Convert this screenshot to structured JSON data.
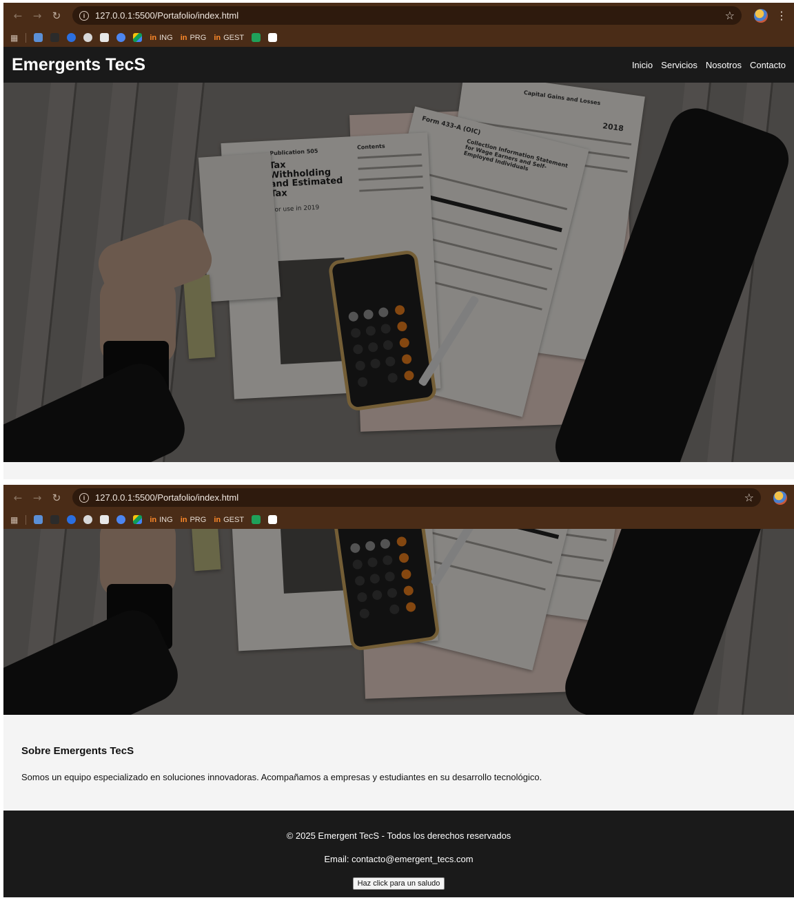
{
  "browser": {
    "url": "127.0.0.1:5500/Portafolio/index.html",
    "bookmarks": [
      {
        "icon": "blue-bottle-icon",
        "label": ""
      },
      {
        "icon": "dark-bottle-icon",
        "label": ""
      },
      {
        "icon": "w-circle-icon",
        "label": ""
      },
      {
        "icon": "openai-icon",
        "label": ""
      },
      {
        "icon": "grid-logo-icon",
        "label": ""
      },
      {
        "icon": "gemini-icon",
        "label": ""
      },
      {
        "icon": "google-drive-icon",
        "label": ""
      },
      {
        "icon": "in-logo-icon",
        "label": "ING"
      },
      {
        "icon": "in-logo-icon",
        "label": "PRG"
      },
      {
        "icon": "in-logo-icon",
        "label": "GEST"
      },
      {
        "icon": "w-green-icon",
        "label": ""
      },
      {
        "icon": "chatgpt-icon",
        "label": ""
      }
    ],
    "bookmark_logo_text": "in"
  },
  "site": {
    "brand": "Emergents TecS",
    "nav": [
      "Inicio",
      "Servicios",
      "Nosotros",
      "Contacto"
    ]
  },
  "hero_image": {
    "doc_publication": "Publication 505",
    "doc_title_lines": [
      "Tax",
      "Withholding",
      "and Estimated",
      "Tax"
    ],
    "doc_for_use": "For use in 2019",
    "doc_contents": "Contents",
    "form_name": "Form 433-A (OIC)",
    "form_heading": "Collection Information Statement for Wage Earners and Self-Employed Individuals",
    "capital_gains": "Capital Gains and Losses",
    "year": "2018"
  },
  "about": {
    "title": "Sobre Emergents TecS",
    "text": "Somos un equipo especializado en soluciones innovadoras. Acompañamos a empresas y estudiantes en su desarrollo tecnológico."
  },
  "footer": {
    "copyright": "© 2025 Emergent TecS - Todos los derechos reservados",
    "email": "Email: contacto@emergent_tecs.com",
    "button_label": "Haz click para un saludo"
  },
  "colors": {
    "browser_frame": "#4a2c17",
    "header_bg": "#1a1a1a",
    "about_bg": "#f4f4f4"
  }
}
